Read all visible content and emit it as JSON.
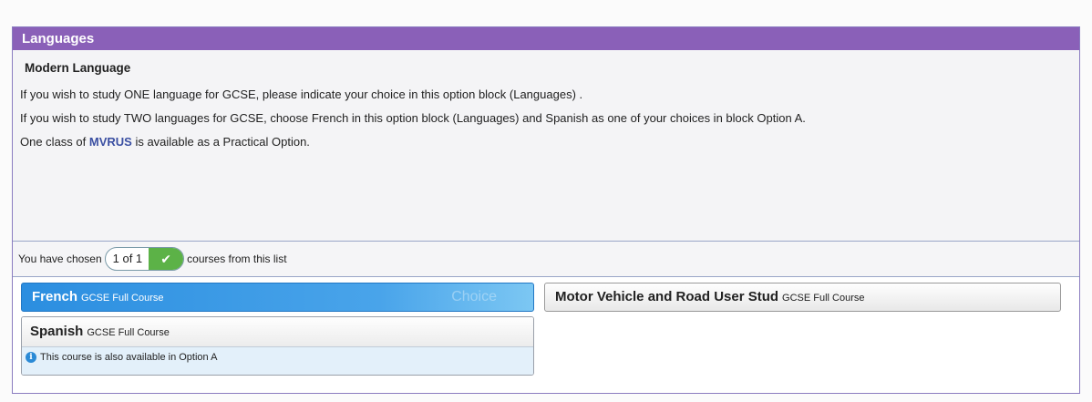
{
  "panel": {
    "title": "Languages",
    "description": {
      "heading": "Modern Language",
      "line1": "If you wish to study ONE language for GCSE, please indicate your choice in this option block (Languages) .",
      "line2": "If you wish to study TWO languages for GCSE, choose French in this option block (Languages) and Spanish as one of your choices in block Option A.",
      "line3_prefix": "One class of ",
      "line3_link": "MVRUS",
      "line3_suffix": " is available as a Practical Option."
    }
  },
  "status": {
    "prefix": "You have chosen",
    "count": "1 of 1",
    "check_icon": "check-icon",
    "suffix": "courses from this list"
  },
  "options": [
    {
      "name": "French",
      "kind": "GCSE Full Course",
      "selected": true,
      "overlay": "Choice"
    },
    {
      "name": "Motor Vehicle and Road User Stud",
      "kind": "GCSE Full Course",
      "selected": false
    },
    {
      "name": "Spanish",
      "kind": "GCSE Full Course",
      "selected": false,
      "note": "This course is also available in Option A",
      "note_icon": "info-icon"
    }
  ],
  "colors": {
    "header_bg": "#8a60b8",
    "selected_bg": "#2b8ee0",
    "check_bg": "#5cb247",
    "link": "#3a4fa2"
  }
}
